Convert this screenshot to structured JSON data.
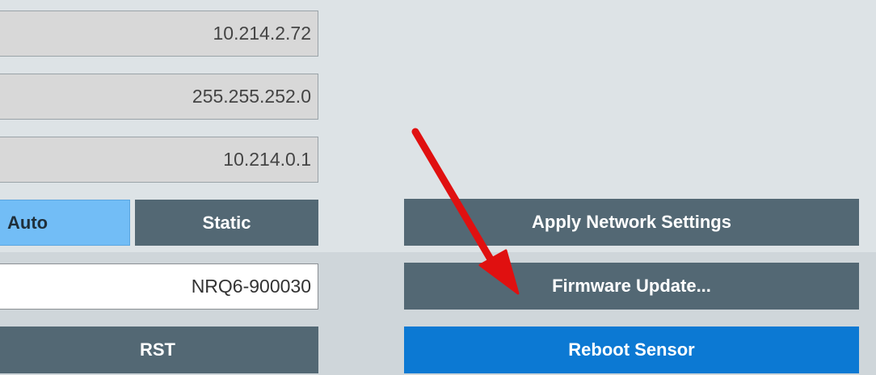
{
  "network": {
    "ip_address": "10.214.2.72",
    "subnet_mask": "255.255.252.0",
    "gateway": "10.214.0.1",
    "mode": {
      "auto_label": "Auto",
      "static_label": "Static",
      "selected": "Auto"
    },
    "apply_label": "Apply Network Settings"
  },
  "device": {
    "name": "NRQ6-900030",
    "rst_label": "RST",
    "firmware_label": "Firmware Update...",
    "reboot_label": "Reboot Sensor"
  },
  "colors": {
    "button": "#536874",
    "selected": "#72bdf6",
    "primary": "#0c79d3",
    "annotation_arrow": "#e01010"
  }
}
